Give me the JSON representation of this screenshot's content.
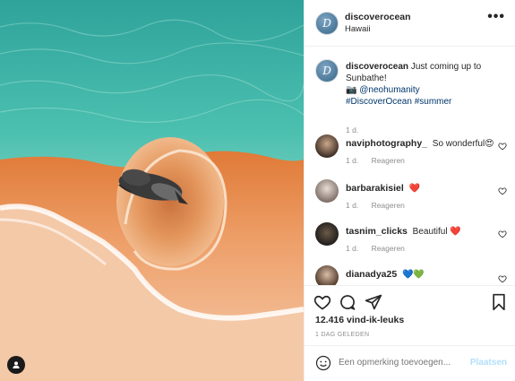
{
  "post": {
    "username": "discoverocean",
    "location": "Hawaii",
    "more_label": "•••",
    "avatar_letter": "D"
  },
  "caption": {
    "username": "discoverocean",
    "text": "Just coming up to Sunbathe!",
    "line2_emoji": "📷",
    "mention": "@neohumanity",
    "hashtags": "#DiscoverOcean #summer",
    "time": "1 d."
  },
  "comments": [
    {
      "username": "naviphotography_",
      "text": "So wonderful😍",
      "time": "1 d.",
      "reply": "Reageren"
    },
    {
      "username": "barbarakisiel",
      "text": "❤️",
      "time": "1 d.",
      "reply": "Reageren"
    },
    {
      "username": "tasnim_clicks",
      "text": "Beautiful ❤️",
      "time": "1 d.",
      "reply": "Reageren"
    },
    {
      "username": "dianadya25",
      "text": "💙💚",
      "time": "",
      "reply": ""
    }
  ],
  "actions": {
    "likes": "12.416 vind-ik-leuks",
    "date": "1 DAG GELEDEN"
  },
  "add_comment": {
    "placeholder": "Een opmerking toevoegen...",
    "post_label": "Plaatsen"
  },
  "colors": {
    "accent_link": "#00376b",
    "post_button_disabled": "#b2dffc",
    "heart_red": "#ed4956"
  }
}
